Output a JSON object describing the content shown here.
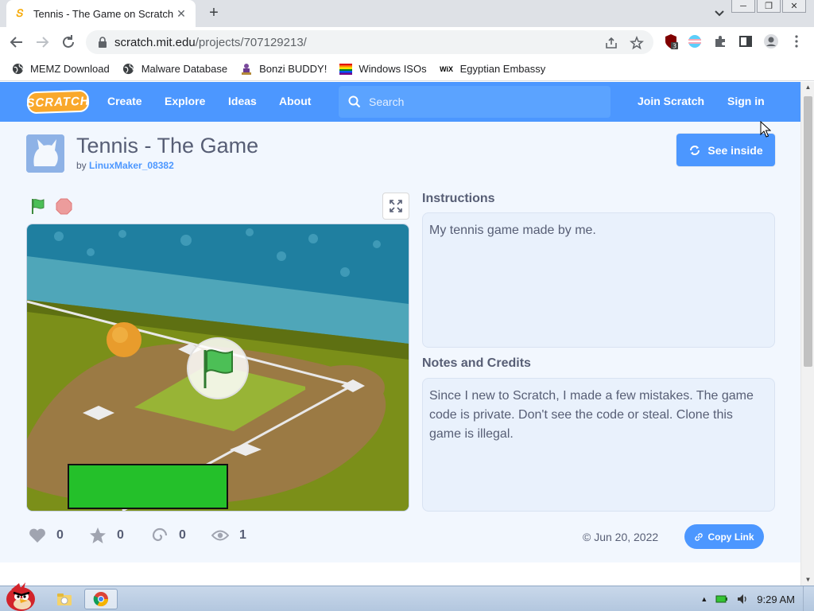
{
  "browser": {
    "tab_title": "Tennis - The Game on Scratch",
    "tab_close": "✕",
    "new_tab": "+",
    "url_domain": "scratch.mit.edu",
    "url_path": "/projects/707129213/",
    "extension_badge": "3",
    "window_controls": [
      "─",
      "❐",
      "✕"
    ]
  },
  "bookmarks": [
    {
      "label": "MEMZ Download",
      "icon": "globe-icon"
    },
    {
      "label": "Malware Database",
      "icon": "globe-icon"
    },
    {
      "label": "Bonzi BUDDY!",
      "icon": "bonzi-icon"
    },
    {
      "label": "Windows ISOs",
      "icon": "rainbow-flag-icon"
    },
    {
      "label": "Egyptian Embassy",
      "icon": "wix-icon"
    }
  ],
  "scratch_nav": {
    "logo": "SCRATCH",
    "links": [
      "Create",
      "Explore",
      "Ideas",
      "About"
    ],
    "search_placeholder": "Search",
    "join": "Join Scratch",
    "sign_in": "Sign in"
  },
  "project": {
    "title": "Tennis - The Game",
    "by_prefix": "by",
    "author": "LinuxMaker_08382",
    "see_inside": "See inside",
    "instructions_heading": "Instructions",
    "instructions": "My tennis game made by me.",
    "notes_heading": "Notes and Credits",
    "notes": "Since I new to Scratch, I made a few mistakes. The game code is private. Don't see the code or steal. Clone this game is illegal.",
    "stats": {
      "loves": "0",
      "favorites": "0",
      "remixes": "0",
      "views": "1"
    },
    "date": "© Jun 20, 2022",
    "copy_link": "Copy Link"
  },
  "taskbar": {
    "clock": "9:29 AM"
  },
  "colors": {
    "scratch_blue": "#4c97ff",
    "page_bg": "#f2f7fe",
    "panel_bg": "#e9f1fc",
    "text": "#575e75"
  }
}
